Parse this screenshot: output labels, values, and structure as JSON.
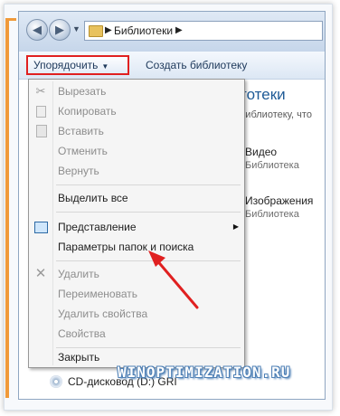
{
  "window": {
    "breadcrumb": "Библиотеки"
  },
  "toolbar": {
    "organize_label": "Упорядочить",
    "new_library_label": "Создать библиотеку"
  },
  "content": {
    "title": "тотеки",
    "subtitle": "библиотеку, что",
    "libraries": [
      {
        "name": "Видео",
        "type": "Библиотека"
      },
      {
        "name": "Изображения",
        "type": "Библиотека"
      }
    ],
    "drive_label": "CD-дисковод (D:) GRI"
  },
  "menu": {
    "items": [
      {
        "label": "Вырезать",
        "enabled": false,
        "icon": "scissors-icon"
      },
      {
        "label": "Копировать",
        "enabled": false,
        "icon": "copy-icon"
      },
      {
        "label": "Вставить",
        "enabled": false,
        "icon": "paste-icon"
      },
      {
        "label": "Отменить",
        "enabled": false
      },
      {
        "label": "Вернуть",
        "enabled": false
      },
      {
        "label": "Выделить все",
        "enabled": true
      },
      {
        "label": "Представление",
        "enabled": true,
        "icon": "layout-icon",
        "submenu": true
      },
      {
        "label": "Параметры папок и поиска",
        "enabled": true
      },
      {
        "label": "Удалить",
        "enabled": false,
        "icon": "delete-x-icon"
      },
      {
        "label": "Переименовать",
        "enabled": false
      },
      {
        "label": "Удалить свойства",
        "enabled": false
      },
      {
        "label": "Свойства",
        "enabled": false
      },
      {
        "label": "Закрыть",
        "enabled": true
      }
    ]
  },
  "watermark": "WINOPTIMIZATION.RU",
  "colors": {
    "highlight_border": "#e02020",
    "annotation_arrow": "#e02020",
    "frame_accent": "#f09a3a",
    "title_blue": "#1e5a96"
  }
}
